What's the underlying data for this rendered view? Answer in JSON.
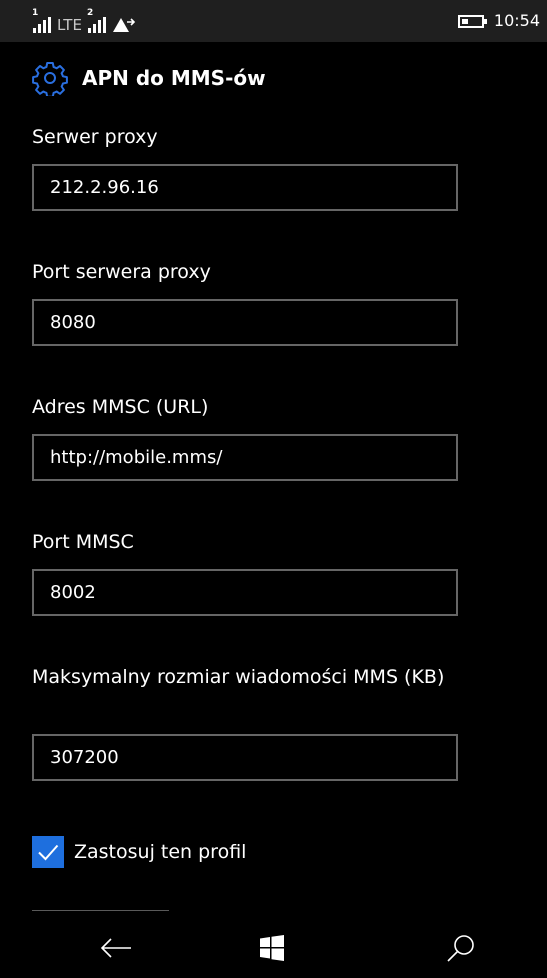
{
  "status_bar": {
    "sim1_label": "1",
    "sim2_label": "2",
    "network_type": "LTE",
    "data_icon": "data-transfer-icon",
    "battery_icon": "battery-icon",
    "battery_level": 0.35,
    "time": "10:54"
  },
  "header": {
    "icon": "gear-icon",
    "title": "APN do MMS-ów"
  },
  "form": {
    "fields": [
      {
        "label": "Serwer proxy",
        "value": "212.2.96.16"
      },
      {
        "label": "Port serwera proxy",
        "value": "8080"
      },
      {
        "label": "Adres MMSC (URL)",
        "value": "http://mobile.mms/"
      },
      {
        "label": "Port MMSC",
        "value": "8002"
      },
      {
        "label": "Maksymalny rozmiar wiadomości MMS (KB)",
        "value": "307200"
      }
    ],
    "apply_profile": {
      "label": "Zastosuj ten profil",
      "checked": true
    }
  },
  "nav_bar": {
    "back_icon": "back-arrow-icon",
    "home_icon": "windows-logo-icon",
    "search_icon": "search-icon"
  },
  "colors": {
    "accent": "#1e6fde",
    "background": "#000000",
    "status_bar": "#1f1f1f",
    "field_border": "#666666",
    "text": "#ffffff"
  }
}
